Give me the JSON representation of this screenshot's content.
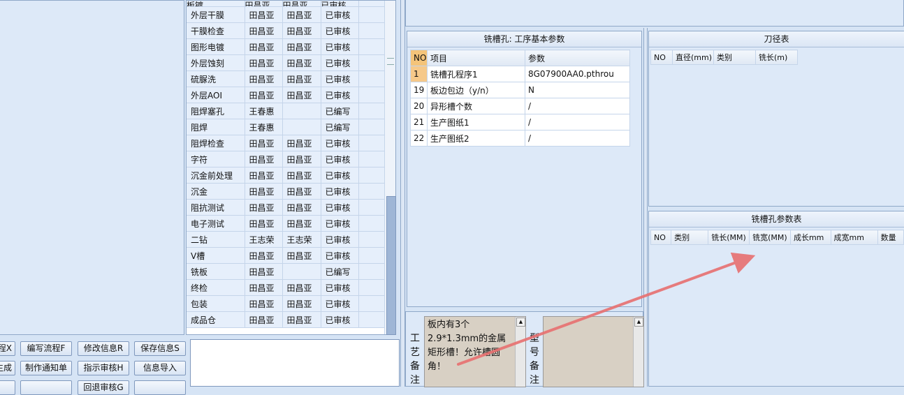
{
  "process_table": {
    "rows": [
      {
        "name": "板镀",
        "maker": "田昌亚",
        "checker": "田昌亚",
        "status": "已审核"
      },
      {
        "name": "外层干膜",
        "maker": "田昌亚",
        "checker": "田昌亚",
        "status": "已审核"
      },
      {
        "name": "干膜检查",
        "maker": "田昌亚",
        "checker": "田昌亚",
        "status": "已审核"
      },
      {
        "name": "图形电镀",
        "maker": "田昌亚",
        "checker": "田昌亚",
        "status": "已审核"
      },
      {
        "name": "外层蚀刻",
        "maker": "田昌亚",
        "checker": "田昌亚",
        "status": "已审核"
      },
      {
        "name": "硫脲洗",
        "maker": "田昌亚",
        "checker": "田昌亚",
        "status": "已审核"
      },
      {
        "name": "外层AOI",
        "maker": "田昌亚",
        "checker": "田昌亚",
        "status": "已审核"
      },
      {
        "name": "阻焊塞孔",
        "maker": "王春惠",
        "checker": "",
        "status": "已编写"
      },
      {
        "name": "阻焊",
        "maker": "王春惠",
        "checker": "",
        "status": "已编写"
      },
      {
        "name": "阻焊检查",
        "maker": "田昌亚",
        "checker": "田昌亚",
        "status": "已审核"
      },
      {
        "name": "字符",
        "maker": "田昌亚",
        "checker": "田昌亚",
        "status": "已审核"
      },
      {
        "name": "沉金前处理",
        "maker": "田昌亚",
        "checker": "田昌亚",
        "status": "已审核"
      },
      {
        "name": "沉金",
        "maker": "田昌亚",
        "checker": "田昌亚",
        "status": "已审核"
      },
      {
        "name": "阻抗测试",
        "maker": "田昌亚",
        "checker": "田昌亚",
        "status": "已审核"
      },
      {
        "name": "电子测试",
        "maker": "田昌亚",
        "checker": "田昌亚",
        "status": "已审核"
      },
      {
        "name": "二钻",
        "maker": "王志荣",
        "checker": "王志荣",
        "status": "已审核"
      },
      {
        "name": "V槽",
        "maker": "田昌亚",
        "checker": "田昌亚",
        "status": "已审核"
      },
      {
        "name": "铣板",
        "maker": "田昌亚",
        "checker": "",
        "status": "已编写"
      },
      {
        "name": "终检",
        "maker": "田昌亚",
        "checker": "田昌亚",
        "status": "已审核"
      },
      {
        "name": "包装",
        "maker": "田昌亚",
        "checker": "田昌亚",
        "status": "已审核"
      },
      {
        "name": "成品仓",
        "maker": "田昌亚",
        "checker": "田昌亚",
        "status": "已审核"
      }
    ]
  },
  "buttons": {
    "row1": [
      "制流程X",
      "编写流程F",
      "修改信息R",
      "保存信息S"
    ],
    "row2": [
      "生成",
      "制作通知单",
      "指示审核H",
      "信息导入"
    ],
    "row3": [
      "",
      "",
      "回退审核G",
      ""
    ]
  },
  "base_params": {
    "title": "铣槽孔: 工序基本参数",
    "headers": {
      "no": "NO",
      "item": "项目",
      "param": "参数"
    },
    "rows": [
      {
        "no": "1",
        "item": "铣槽孔程序1",
        "param": "8G07900AA0.pthrou"
      },
      {
        "no": "19",
        "item": "板边包边（y/n）",
        "param": "N"
      },
      {
        "no": "20",
        "item": "异形槽个数",
        "param": "/"
      },
      {
        "no": "21",
        "item": "生产图纸1",
        "param": "/"
      },
      {
        "no": "22",
        "item": "生产图纸2",
        "param": "/"
      }
    ]
  },
  "tool_table": {
    "title": "刀径表",
    "headers": [
      "NO",
      "直径(mm)",
      "类别",
      "铣长(m)"
    ]
  },
  "slot_table": {
    "title": "铣槽孔参数表",
    "headers": [
      "NO",
      "类别",
      "铣长(MM)",
      "铣宽(MM)",
      "成长mm",
      "成宽mm",
      "数量"
    ]
  },
  "memo": {
    "process_label": "工艺备注",
    "process_text": "板内有3个2.9*1.3mm的金属矩形槽！允许槽圆角！",
    "model_label": "型号备注",
    "model_text": ""
  },
  "colors": {
    "annotation_arrow": "#e87070",
    "selected_no": "#f6c98a"
  }
}
